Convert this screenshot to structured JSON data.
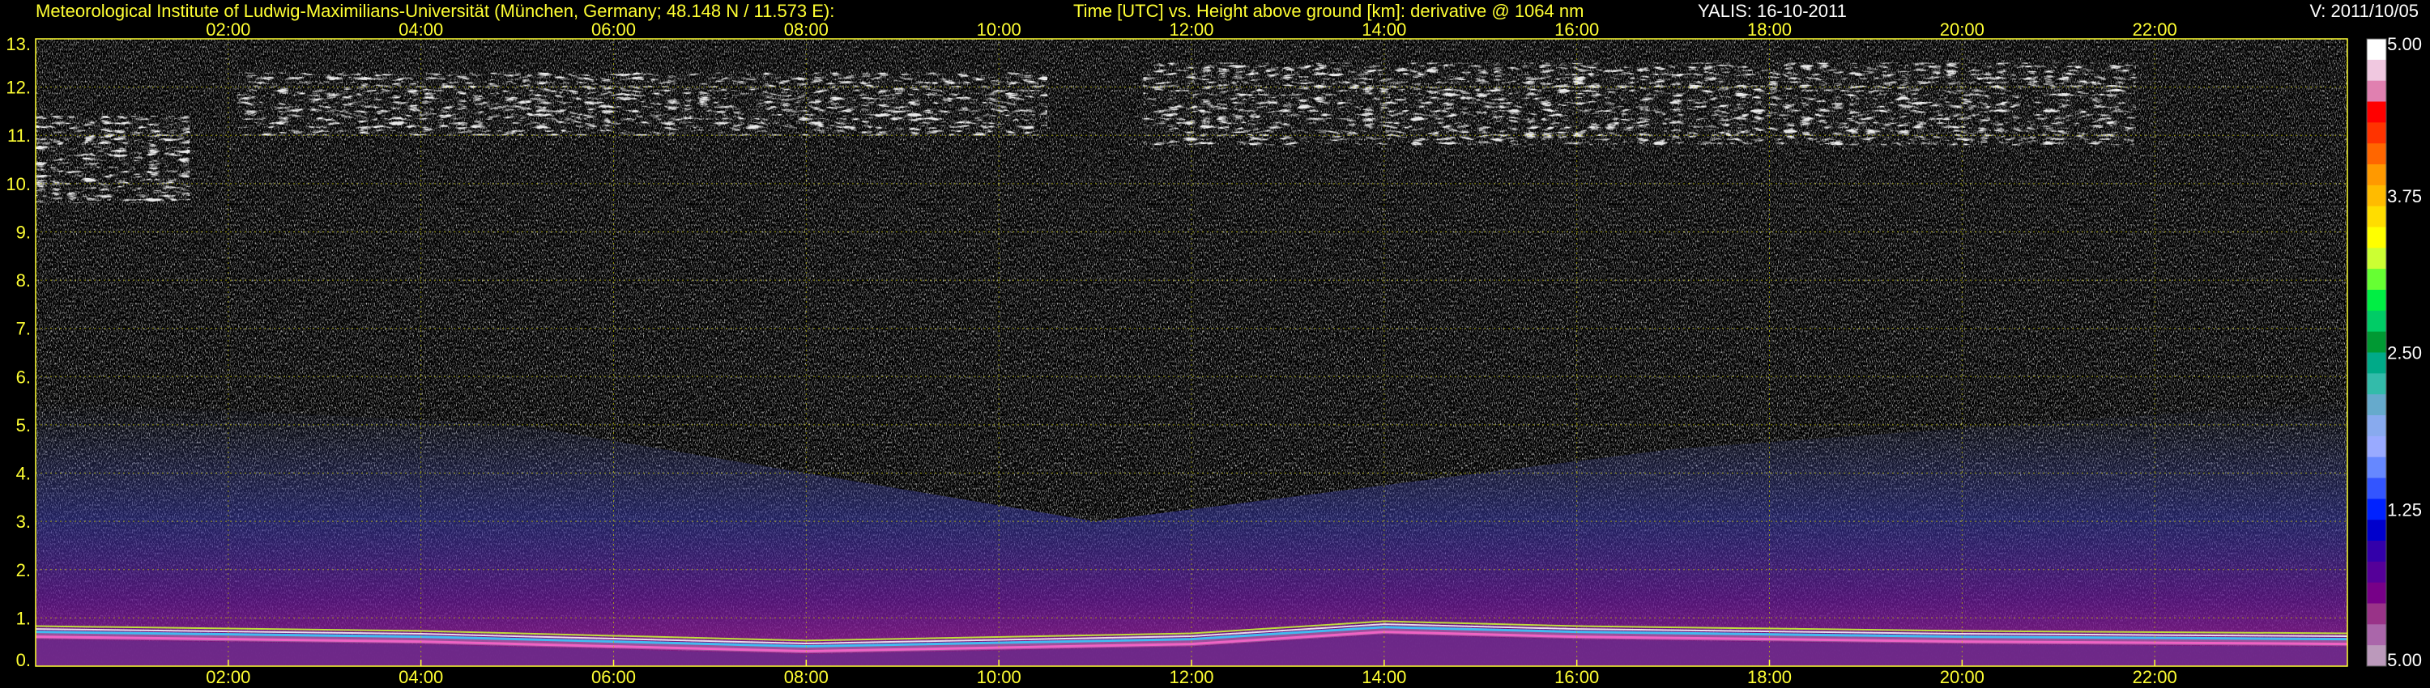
{
  "header": {
    "institute": "Meteorological Institute of Ludwig-Maximilians-Universität (München, Germany; 48.148 N / 11.573 E):",
    "plot_description": "Time [UTC] vs. Height above ground [km]: derivative @ 1064 nm",
    "instrument_date": "YALIS: 16-10-2011",
    "version": "V: 2011/10/05"
  },
  "colors": {
    "axis_text": "#ffff33",
    "header_white": "#ffffff",
    "grid": "#c8c800",
    "background": "#000000"
  },
  "chart_data": {
    "type": "heatmap",
    "x_axis": {
      "range": [
        0,
        24
      ],
      "ticks": [
        2,
        4,
        6,
        8,
        10,
        12,
        14,
        16,
        18,
        20,
        22
      ],
      "tick_labels": [
        "02:00",
        "04:00",
        "06:00",
        "08:00",
        "10:00",
        "12:00",
        "14:00",
        "16:00",
        "18:00",
        "20:00",
        "22:00"
      ]
    },
    "y_axis": {
      "range": [
        0,
        13
      ],
      "ticks": [
        0,
        1,
        2,
        3,
        4,
        5,
        6,
        7,
        8,
        9,
        10,
        11,
        12,
        13
      ],
      "tick_labels": [
        "0.",
        "1.",
        "2.",
        "3.",
        "4.",
        "5.",
        "6.",
        "7.",
        "8.",
        "9.",
        "10.",
        "11.",
        "12.",
        "13."
      ]
    },
    "grid": true,
    "colorbar": {
      "labels": [
        "5.00",
        "3.75",
        "2.50",
        "1.25",
        "5.00"
      ],
      "label_positions": [
        5.0,
        3.75,
        2.5,
        1.25,
        0
      ],
      "colors": [
        "#ffffff",
        "#f0c8e0",
        "#e080b0",
        "#ff0000",
        "#ff3300",
        "#ff6600",
        "#ff9900",
        "#ffbb00",
        "#ffdd00",
        "#ffff00",
        "#ccff33",
        "#66ff33",
        "#00ee44",
        "#00cc66",
        "#009933",
        "#00aa88",
        "#33bbaa",
        "#66aacc",
        "#88aaee",
        "#99aaff",
        "#6688ff",
        "#3355ff",
        "#0022ff",
        "#0000cc",
        "#3300aa",
        "#550099",
        "#770088",
        "#993388",
        "#aa66aa",
        "#bb99bb"
      ]
    },
    "features": {
      "cirrus_high": [
        {
          "t_start": 0.0,
          "t_end": 1.6,
          "h_bottom": 9.6,
          "h_top": 11.4
        },
        {
          "t_start": 2.1,
          "t_end": 10.5,
          "h_bottom": 11.0,
          "h_top": 12.3
        },
        {
          "t_start": 11.5,
          "t_end": 21.8,
          "h_bottom": 10.8,
          "h_top": 12.5
        }
      ],
      "boundary_layer": [
        {
          "t": 0,
          "h": 0.65
        },
        {
          "t": 4,
          "h": 0.55
        },
        {
          "t": 8,
          "h": 0.35
        },
        {
          "t": 12,
          "h": 0.5
        },
        {
          "t": 14,
          "h": 0.75
        },
        {
          "t": 16,
          "h": 0.65
        },
        {
          "t": 20,
          "h": 0.55
        },
        {
          "t": 24,
          "h": 0.5
        }
      ],
      "aerosol_haze_top": [
        {
          "t": 0,
          "h": 5.5
        },
        {
          "t": 5,
          "h": 5.0
        },
        {
          "t": 11,
          "h": 3.0
        },
        {
          "t": 17,
          "h": 4.5
        },
        {
          "t": 24,
          "h": 5.5
        }
      ]
    }
  }
}
